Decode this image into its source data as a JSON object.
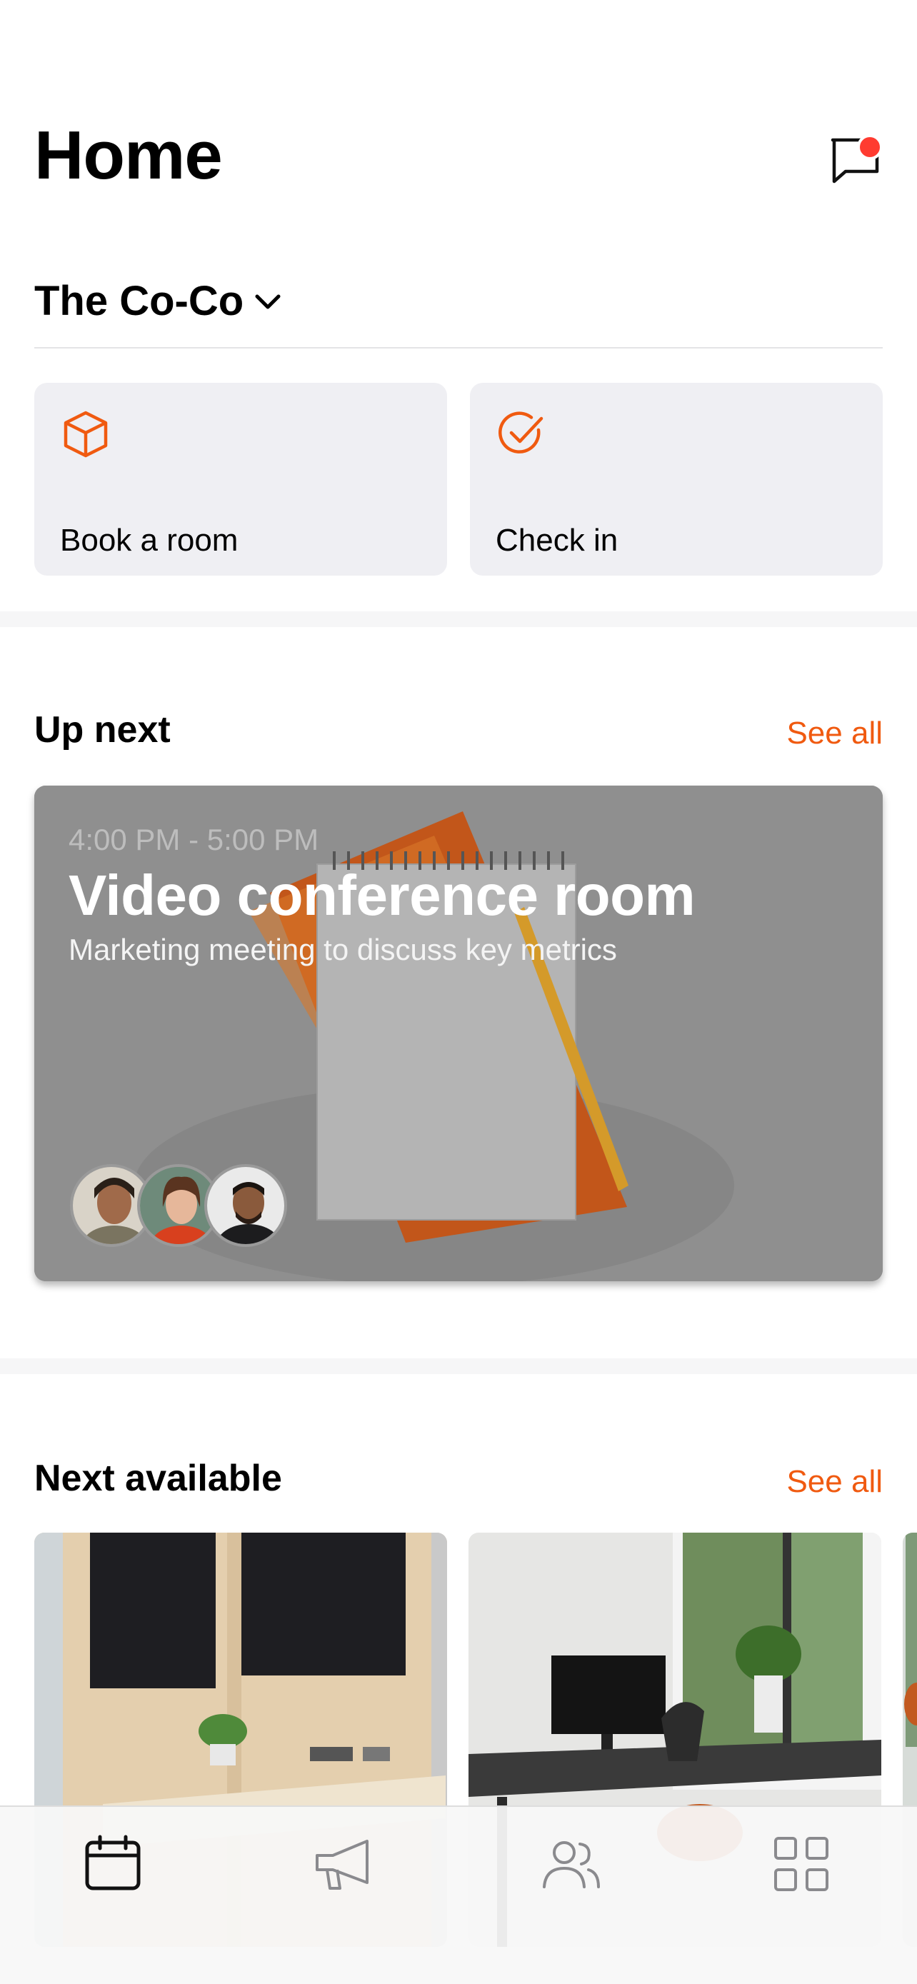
{
  "header": {
    "title": "Home"
  },
  "location": {
    "name": "The Co-Co"
  },
  "actions": [
    {
      "label": "Book a room",
      "icon": "cube-icon"
    },
    {
      "label": "Check in",
      "icon": "check-circle-icon"
    }
  ],
  "up_next": {
    "title": "Up next",
    "see_all": "See all",
    "event": {
      "time": "4:00 PM - 5:00 PM",
      "title": "Video conference room",
      "description": "Marketing meeting to discuss key metrics"
    }
  },
  "next_available": {
    "title": "Next available",
    "see_all": "See all"
  },
  "tabbar": {
    "tabs": [
      {
        "icon": "calendar-icon",
        "active": true
      },
      {
        "icon": "megaphone-icon",
        "active": false
      },
      {
        "icon": "people-icon",
        "active": false
      },
      {
        "icon": "grid-icon",
        "active": false
      }
    ]
  },
  "colors": {
    "accent": "#f05a10",
    "notification": "#ff3b30",
    "card_bg": "#efeff3"
  }
}
